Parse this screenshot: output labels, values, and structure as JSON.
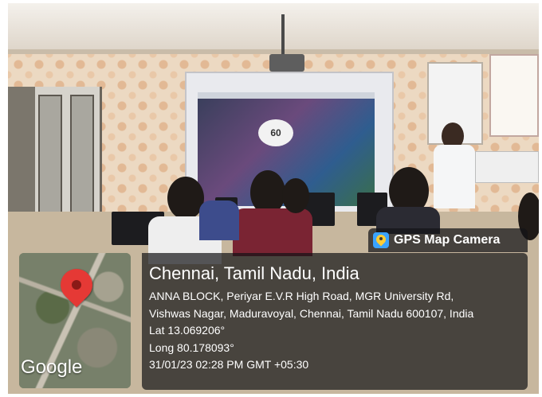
{
  "gps_tag": {
    "label": "GPS Map Camera",
    "icon": "gps-map-camera-icon"
  },
  "map": {
    "brand": "Google",
    "marker_icon": "location-pin-icon",
    "marker_color": "#e53935"
  },
  "location": {
    "title": "Chennai, Tamil Nadu, India",
    "address_line_1": "ANNA BLOCK, Periyar E.V.R High Road, MGR University Rd,",
    "address_line_2": "Vishwas Nagar, Maduravoyal, Chennai, Tamil Nadu 600107, India",
    "latitude": "Lat 13.069206°",
    "longitude": "Long 80.178093°",
    "timestamp": "31/01/23 02:28 PM GMT +05:30"
  },
  "slide": {
    "badge": "60"
  }
}
